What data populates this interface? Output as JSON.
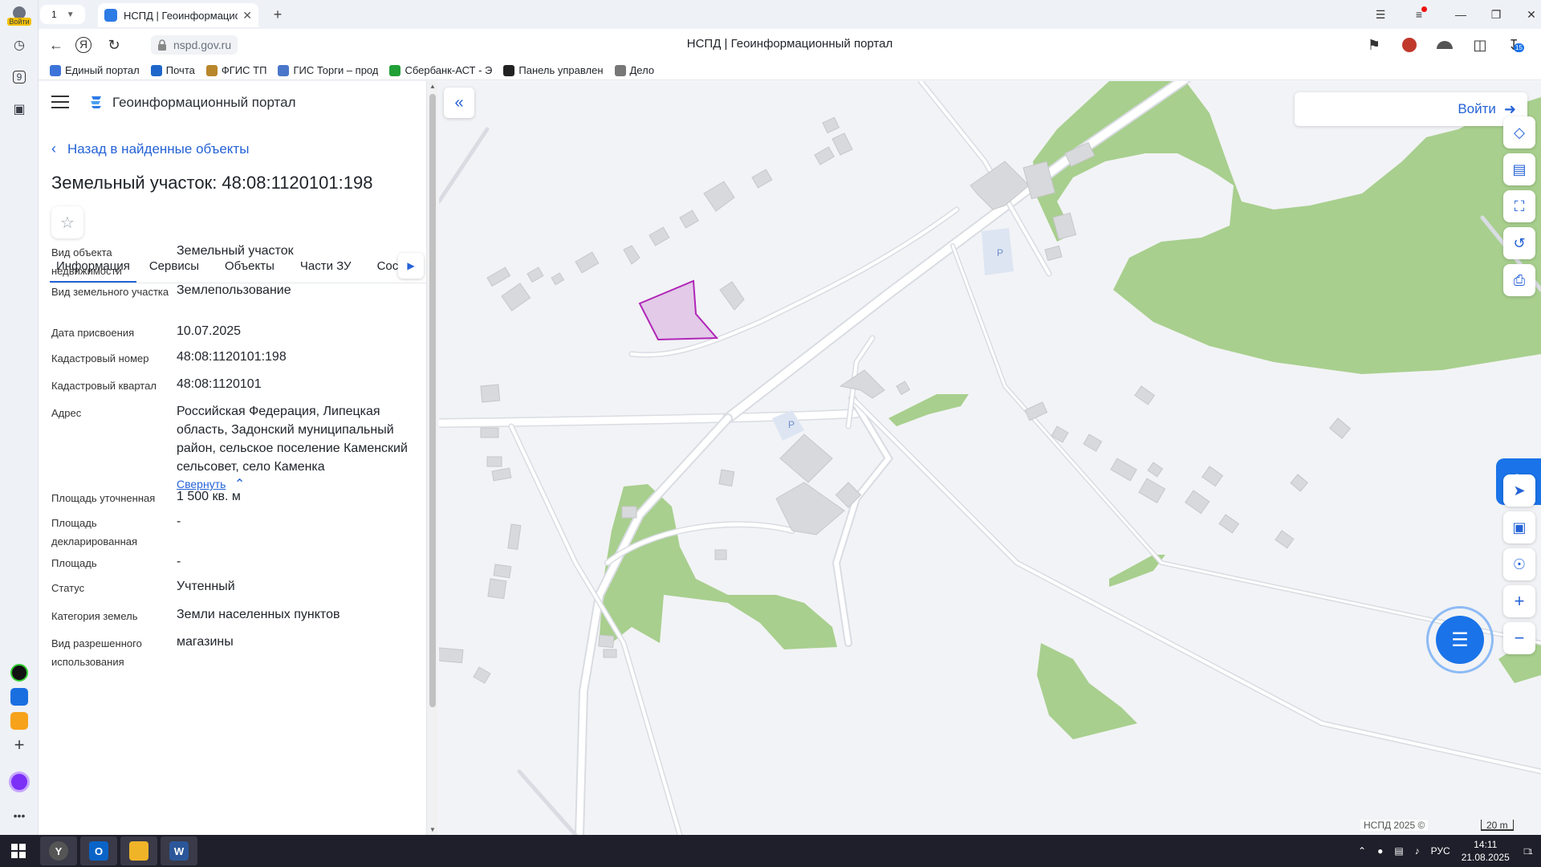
{
  "browser": {
    "tab_count": "1",
    "active_tab_title": "НСПД | Геоинформацио",
    "url": "nspd.gov.ru",
    "page_title": "НСПД | Геоинформационный портал",
    "profile_label": "Войти",
    "download_badge": "15",
    "rail_number": "9"
  },
  "bookmarks": [
    {
      "label": "Единый портал",
      "color": "#3c74d9"
    },
    {
      "label": "Почта",
      "color": "#1e66c9"
    },
    {
      "label": "ФГИС ТП",
      "color": "#b8862b"
    },
    {
      "label": "ГИС Торги – прод",
      "color": "#4a77c9"
    },
    {
      "label": "Сбербанк-АСТ - Э",
      "color": "#21a038"
    },
    {
      "label": "Панель управлен",
      "color": "#222"
    },
    {
      "label": "Дело",
      "color": "#777"
    }
  ],
  "panel": {
    "portal_title": "Геоинформационный портал",
    "back_link": "Назад в найденные объекты",
    "title": "Земельный участок: 48:08:1120101:198",
    "tabs": [
      "Информация",
      "Сервисы",
      "Объекты",
      "Части ЗУ",
      "Соста"
    ],
    "active_tab": 0,
    "collapse_label": "Свернуть",
    "fields": [
      {
        "label": "Вид объекта недвижимости",
        "value": "Земельный участок"
      },
      {
        "label": "Вид земельного участка",
        "value": "Землепользование"
      },
      {
        "label": "Дата присвоения",
        "value": "10.07.2025"
      },
      {
        "label": "Кадастровый номер",
        "value": "48:08:1120101:198"
      },
      {
        "label": "Кадастровый квартал",
        "value": "48:08:1120101"
      },
      {
        "label": "Адрес",
        "value": "Российская Федерация, Липецкая область, Задонский муниципальный район, сельское поселение Каменский сельсовет, село Каменка"
      },
      {
        "label": "Площадь уточненная",
        "value": "1 500 кв. м"
      },
      {
        "label": "Площадь декларированная",
        "value": "-"
      },
      {
        "label": "Площадь",
        "value": "-"
      },
      {
        "label": "Статус",
        "value": "Учтенный"
      },
      {
        "label": "Категория земель",
        "value": "Земли населенных пунктов"
      },
      {
        "label": "Вид разрешенного использования",
        "value": "магазины"
      }
    ]
  },
  "map": {
    "login_label": "Войти",
    "copyright": "НСПД 2025 ©",
    "scale_label": "20 m",
    "parking_label": "P",
    "parcel_color": "#b026b8",
    "green_color": "#a8cf8e"
  },
  "taskbar": {
    "lang": "РУС",
    "time": "14:11",
    "date": "21.08.2025",
    "notif_count": "1"
  }
}
